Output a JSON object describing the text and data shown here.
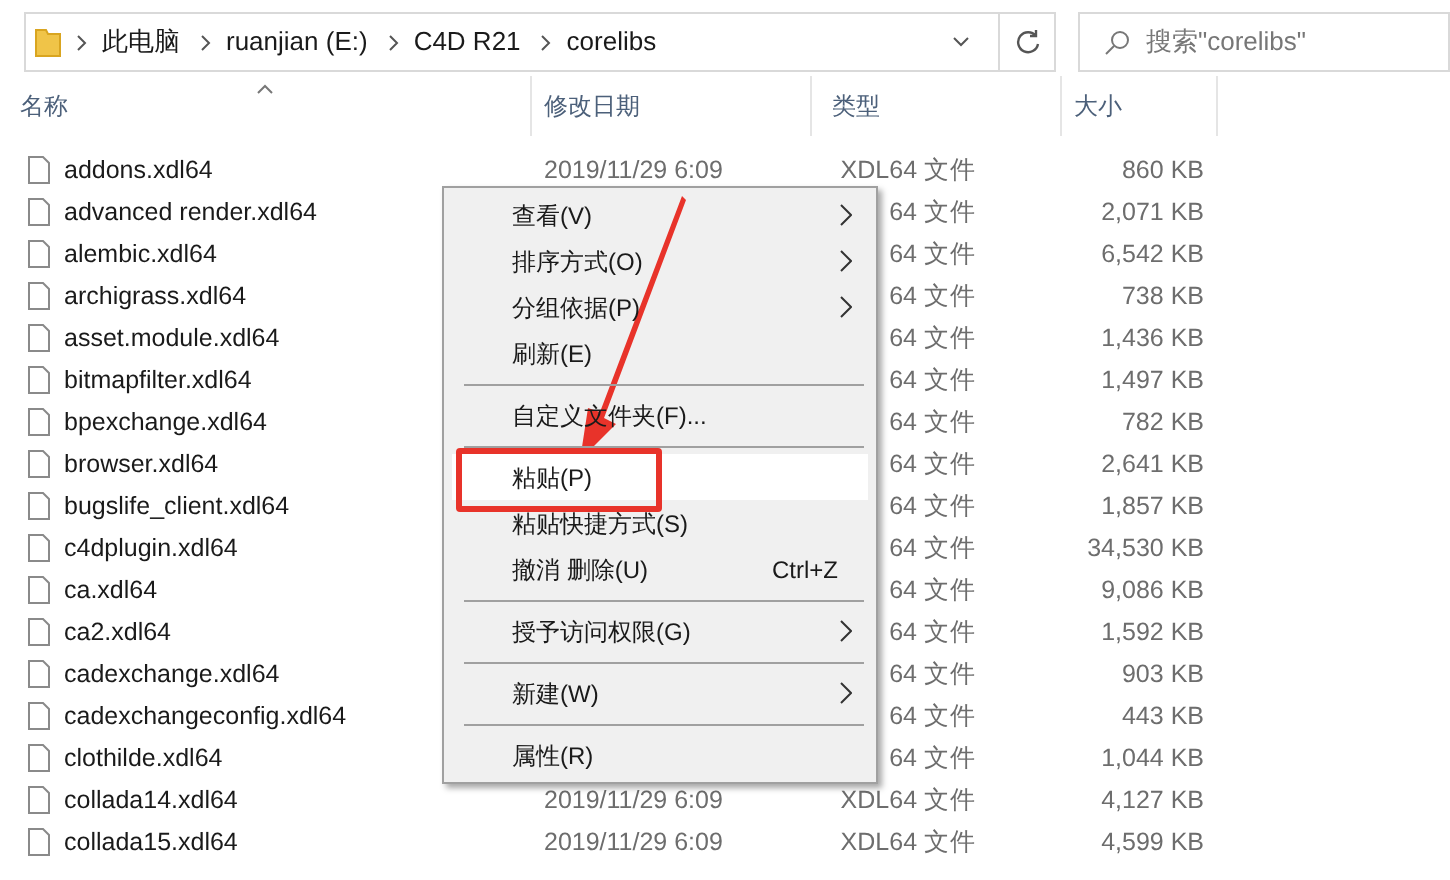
{
  "address_bar": {
    "breadcrumbs": [
      "此电脑",
      "ruanjian (E:)",
      "C4D R21",
      "corelibs"
    ]
  },
  "search": {
    "placeholder": "搜索\"corelibs\""
  },
  "columns": [
    "名称",
    "修改日期",
    "类型",
    "大小"
  ],
  "files": [
    {
      "name": "addons.xdl64",
      "date": "2019/11/29 6:09",
      "type": "XDL64 文件",
      "size": "860 KB"
    },
    {
      "name": "advanced render.xdl64",
      "type": "64 文件",
      "size": "2,071 KB"
    },
    {
      "name": "alembic.xdl64",
      "type": "64 文件",
      "size": "6,542 KB"
    },
    {
      "name": "archigrass.xdl64",
      "type": "64 文件",
      "size": "738 KB"
    },
    {
      "name": "asset.module.xdl64",
      "type": "64 文件",
      "size": "1,436 KB"
    },
    {
      "name": "bitmapfilter.xdl64",
      "type": "64 文件",
      "size": "1,497 KB"
    },
    {
      "name": "bpexchange.xdl64",
      "type": "64 文件",
      "size": "782 KB"
    },
    {
      "name": "browser.xdl64",
      "type": "64 文件",
      "size": "2,641 KB"
    },
    {
      "name": "bugslife_client.xdl64",
      "type": "64 文件",
      "size": "1,857 KB"
    },
    {
      "name": "c4dplugin.xdl64",
      "type": "64 文件",
      "size": "34,530 KB"
    },
    {
      "name": "ca.xdl64",
      "type": "64 文件",
      "size": "9,086 KB"
    },
    {
      "name": "ca2.xdl64",
      "type": "64 文件",
      "size": "1,592 KB"
    },
    {
      "name": "cadexchange.xdl64",
      "type": "64 文件",
      "size": "903 KB"
    },
    {
      "name": "cadexchangeconfig.xdl64",
      "type": "64 文件",
      "size": "443 KB"
    },
    {
      "name": "clothilde.xdl64",
      "type": "64 文件",
      "size": "1,044 KB"
    },
    {
      "name": "collada14.xdl64",
      "date": "2019/11/29 6:09",
      "type": "XDL64 文件",
      "size": "4,127 KB"
    },
    {
      "name": "collada15.xdl64",
      "date": "2019/11/29 6:09",
      "type": "XDL64 文件",
      "size": "4,599 KB"
    }
  ],
  "context_menu": [
    {
      "kind": "item",
      "label": "查看(V)",
      "submenu": true,
      "selected": false
    },
    {
      "kind": "item",
      "label": "排序方式(O)",
      "submenu": true,
      "selected": false
    },
    {
      "kind": "item",
      "label": "分组依据(P)",
      "submenu": true,
      "selected": false
    },
    {
      "kind": "item",
      "label": "刷新(E)",
      "submenu": false,
      "selected": false
    },
    {
      "kind": "separator"
    },
    {
      "kind": "item",
      "label": "自定义文件夹(F)...",
      "submenu": false,
      "selected": false
    },
    {
      "kind": "separator"
    },
    {
      "kind": "item",
      "label": "粘贴(P)",
      "submenu": false,
      "selected": true
    },
    {
      "kind": "item",
      "label": "粘贴快捷方式(S)",
      "submenu": false,
      "selected": false
    },
    {
      "kind": "item",
      "label": "撤消 删除(U)",
      "shortcut": "Ctrl+Z",
      "submenu": false,
      "selected": false
    },
    {
      "kind": "separator"
    },
    {
      "kind": "item",
      "label": "授予访问权限(G)",
      "submenu": true,
      "selected": false
    },
    {
      "kind": "separator"
    },
    {
      "kind": "item",
      "label": "新建(W)",
      "submenu": true,
      "selected": false
    },
    {
      "kind": "separator"
    },
    {
      "kind": "item",
      "label": "属性(R)",
      "submenu": false,
      "selected": false
    }
  ]
}
